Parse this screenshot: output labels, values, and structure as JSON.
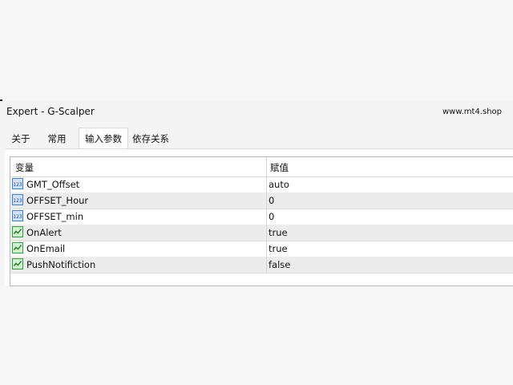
{
  "window": {
    "title": "Expert - G-Scalper",
    "brand": "www.mt4.shop"
  },
  "tabs": [
    {
      "label": "关于"
    },
    {
      "label": "常用"
    },
    {
      "label": "输入参数",
      "active": true
    },
    {
      "label": "依存关系"
    }
  ],
  "grid": {
    "headers": {
      "variable": "变量",
      "value": "赋值"
    },
    "rows": [
      {
        "name": "GMT_Offset",
        "value": "auto",
        "icon": "numeric-icon"
      },
      {
        "name": "OFFSET_Hour",
        "value": "0",
        "icon": "numeric-icon"
      },
      {
        "name": "OFFSET_min",
        "value": "0",
        "icon": "numeric-icon"
      },
      {
        "name": "OnAlert",
        "value": "true",
        "icon": "boolean-icon"
      },
      {
        "name": "OnEmail",
        "value": "true",
        "icon": "boolean-icon"
      },
      {
        "name": "PushNotifiction",
        "value": "false",
        "icon": "boolean-icon"
      }
    ]
  },
  "colors": {
    "numeric_icon": "#3f7fd0",
    "boolean_icon": "#2f9e35",
    "row_alt": "#ececec"
  }
}
